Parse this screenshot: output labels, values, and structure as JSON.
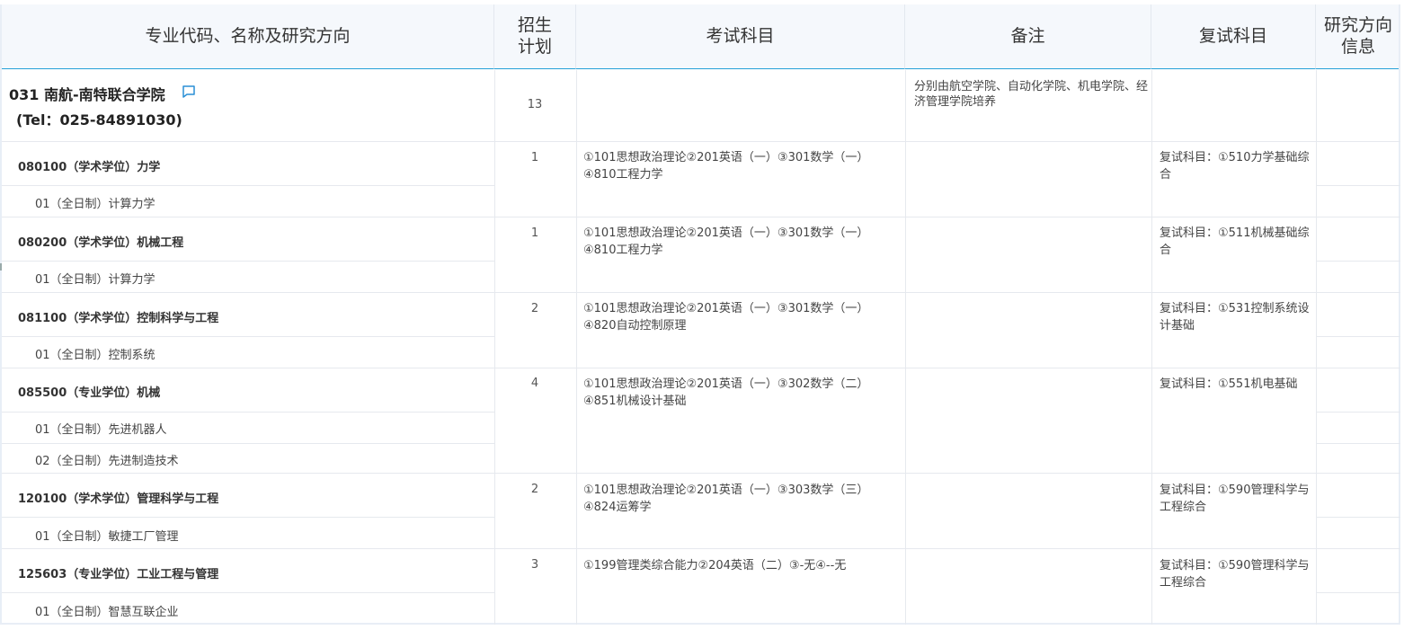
{
  "headers": {
    "major": "专业代码、名称及研究方向",
    "plan": "招生\n计划",
    "exam": "考试科目",
    "note": "备注",
    "retest": "复试科目",
    "info": "研究方向\n信息"
  },
  "department": {
    "name": "031 南航-南特联合学院",
    "tel": "(Tel：025-84891030)",
    "plan": "13",
    "note": "分别由航空学院、自动化学院、机电学院、经济管理学院培养"
  },
  "majors": [
    {
      "title": "080100（学术学位）力学",
      "plan": "1",
      "exam": "①101思想政治理论②201英语（一）③301数学（一）④810工程力学",
      "retest": "复试科目：①510力学基础综合",
      "directions": [
        "01（全日制）计算力学"
      ]
    },
    {
      "title": "080200（学术学位）机械工程",
      "plan": "1",
      "exam": "①101思想政治理论②201英语（一）③301数学（一）④810工程力学",
      "retest": "复试科目：①511机械基础综合",
      "directions": [
        "01（全日制）计算力学"
      ]
    },
    {
      "title": "081100（学术学位）控制科学与工程",
      "plan": "2",
      "exam": "①101思想政治理论②201英语（一）③301数学（一）④820自动控制原理",
      "retest": "复试科目：①531控制系统设计基础",
      "directions": [
        "01（全日制）控制系统"
      ]
    },
    {
      "title": "085500（专业学位）机械",
      "plan": "4",
      "exam": "①101思想政治理论②201英语（一）③302数学（二）④851机械设计基础",
      "retest": "复试科目：①551机电基础",
      "directions": [
        "01（全日制）先进机器人",
        "02（全日制）先进制造技术"
      ]
    },
    {
      "title": "120100（学术学位）管理科学与工程",
      "plan": "2",
      "exam": "①101思想政治理论②201英语（一）③303数学（三）④824运筹学",
      "retest": "复试科目：①590管理科学与工程综合",
      "directions": [
        "01（全日制）敏捷工厂管理"
      ]
    },
    {
      "title": "125603（专业学位）工业工程与管理",
      "plan": "3",
      "exam": "①199管理类综合能力②204英语（二）③-无④--无",
      "retest": "复试科目：①590管理科学与工程综合",
      "directions": [
        "01（全日制）智慧互联企业"
      ]
    }
  ],
  "icons": {
    "comment": "comment-icon"
  },
  "colors": {
    "header_bg": "#f5f8fc",
    "header_border": "#26a1d8",
    "icon": "#2a8fd6"
  }
}
